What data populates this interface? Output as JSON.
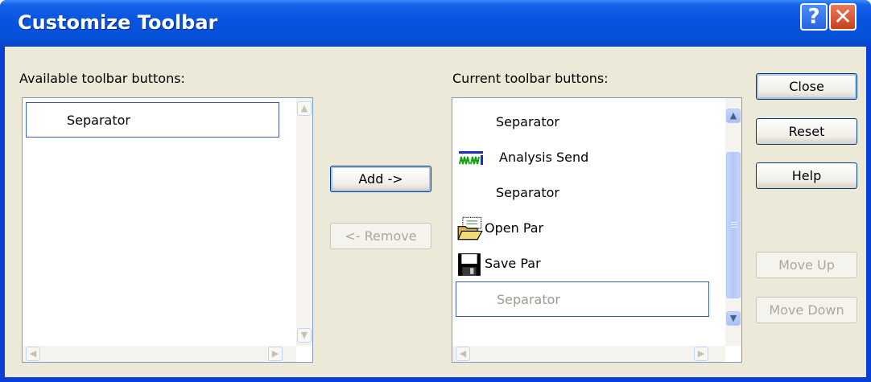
{
  "window": {
    "title": "Customize Toolbar"
  },
  "titlebar": {
    "help_glyph": "?",
    "close_glyph": "✕"
  },
  "available": {
    "label": "Available toolbar buttons:",
    "items": [
      {
        "label": "Separator",
        "icon": "none",
        "selected": true
      }
    ]
  },
  "current": {
    "label": "Current toolbar buttons:",
    "items": [
      {
        "label": "Separator",
        "icon": "none"
      },
      {
        "label": "Analysis Send",
        "icon": "analysis-send-icon"
      },
      {
        "label": "Separator",
        "icon": "none"
      },
      {
        "label": "Open Par",
        "icon": "open-folder-icon"
      },
      {
        "label": "Save Par",
        "icon": "floppy-save-icon"
      },
      {
        "label": "Separator",
        "icon": "none",
        "selected": true
      }
    ]
  },
  "buttons": {
    "add": "Add ->",
    "remove": "<- Remove",
    "close": "Close",
    "reset": "Reset",
    "help": "Help",
    "move_up": "Move Up",
    "move_down": "Move Down"
  },
  "colors": {
    "title_bar": "#0853e0",
    "dialog_face": "#ece9d8",
    "disabled_text": "#aca899",
    "selection_border": "#3a5bb8"
  }
}
